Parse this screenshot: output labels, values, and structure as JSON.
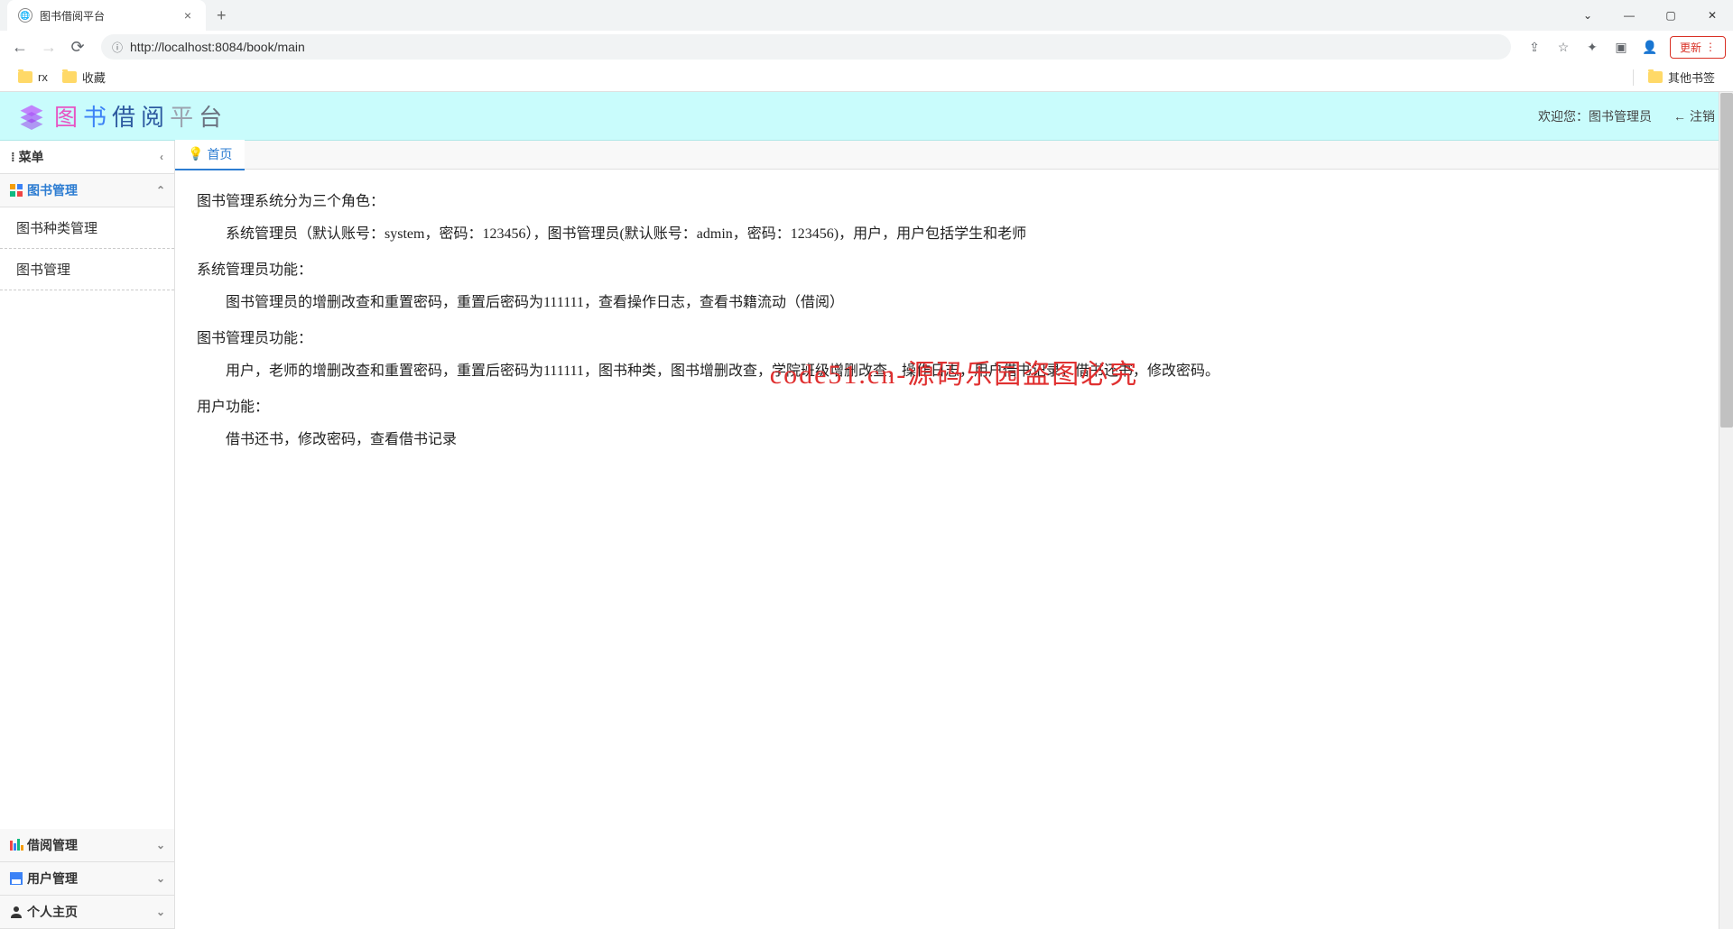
{
  "browser": {
    "tab_title": "图书借阅平台",
    "url": "http://localhost:8084/book/main",
    "update_label": "更新",
    "bookmarks": {
      "rx": "rx",
      "fav": "收藏",
      "other": "其他书签"
    }
  },
  "header": {
    "logo_chars": [
      "图",
      "书",
      "借",
      "阅",
      "平",
      "台"
    ],
    "welcome_prefix": "欢迎您：",
    "user_role": "图书管理员",
    "logout": "注销"
  },
  "sidebar": {
    "menu_label": "菜单",
    "groups": [
      {
        "label": "图书管理",
        "expanded": true,
        "items": [
          "图书种类管理",
          "图书管理"
        ]
      },
      {
        "label": "借阅管理",
        "expanded": false
      },
      {
        "label": "用户管理",
        "expanded": false
      },
      {
        "label": "个人主页",
        "expanded": false
      }
    ]
  },
  "content": {
    "tab_home": "首页",
    "p1": "图书管理系统分为三个角色：",
    "p1a": "系统管理员（默认账号：system，密码：123456），图书管理员(默认账号：admin，密码：123456)，用户，用户包括学生和老师",
    "p2": "系统管理员功能：",
    "p2a": "图书管理员的增删改查和重置密码，重置后密码为111111，查看操作日志，查看书籍流动（借阅）",
    "p3": "图书管理员功能：",
    "p3a": "用户，老师的增删改查和重置密码，重置后密码为111111，图书种类，图书增删改查，学院班级增删改查，操作日志，用户借书记录，借书还书，修改密码。",
    "p4": "用户功能：",
    "p4a": "借书还书，修改密码，查看借书记录"
  },
  "watermark": "code51.cn-源码乐园盗图必究"
}
